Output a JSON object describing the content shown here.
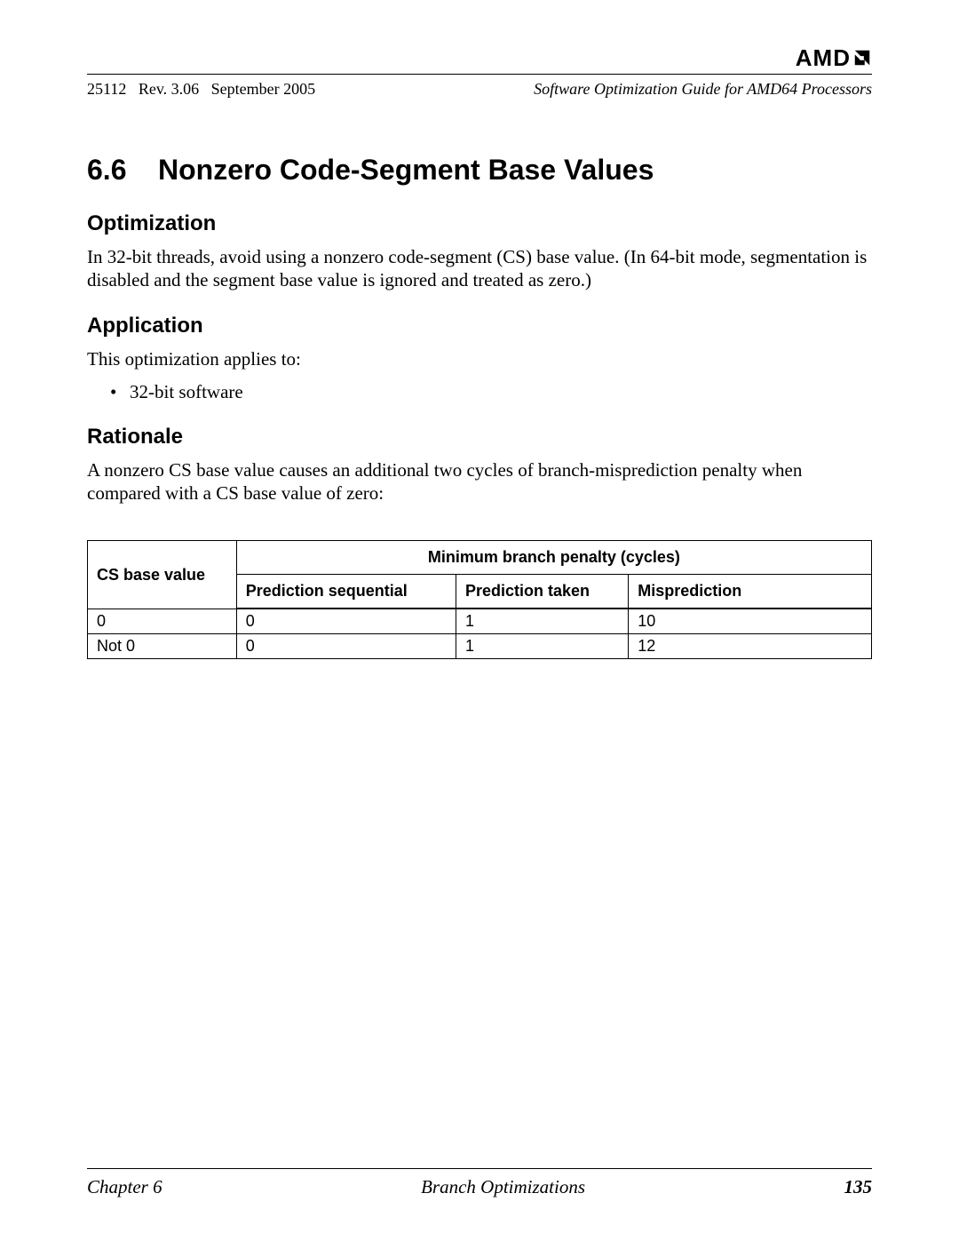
{
  "header": {
    "logo_text": "AMD",
    "doc_id": "25112",
    "rev": "Rev. 3.06",
    "date": "September 2005",
    "doc_title": "Software Optimization Guide for AMD64 Processors"
  },
  "section": {
    "number": "6.6",
    "title": "Nonzero Code-Segment Base Values"
  },
  "optimization": {
    "heading": "Optimization",
    "text": "In 32-bit threads, avoid using a nonzero code-segment (CS) base value. (In 64-bit mode, segmentation is disabled and the segment base value is ignored and treated as zero.)"
  },
  "application": {
    "heading": "Application",
    "intro": "This optimization applies to:",
    "items": [
      "32-bit software"
    ]
  },
  "rationale": {
    "heading": "Rationale",
    "text": "A nonzero CS base value causes an additional two cycles of branch-misprediction penalty when compared with a CS base value of zero:"
  },
  "table": {
    "col0_header": "CS base value",
    "span_header": "Minimum branch penalty (cycles)",
    "sub_headers": [
      "Prediction sequential",
      "Prediction taken",
      "Misprediction"
    ],
    "rows": [
      {
        "label": "0",
        "vals": [
          "0",
          "1",
          "10"
        ]
      },
      {
        "label": "Not 0",
        "vals": [
          "0",
          "1",
          "12"
        ]
      }
    ]
  },
  "footer": {
    "chapter": "Chapter 6",
    "title": "Branch Optimizations",
    "page": "135"
  }
}
